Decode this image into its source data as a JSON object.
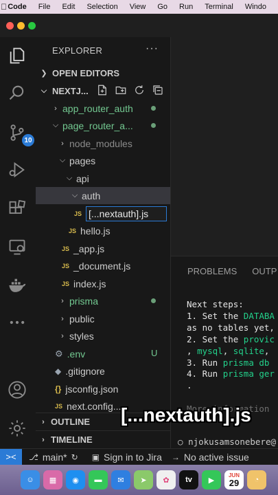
{
  "menubar": {
    "apple": "",
    "items": [
      "Code",
      "File",
      "Edit",
      "Selection",
      "View",
      "Go",
      "Run",
      "Terminal",
      "Windo"
    ]
  },
  "activity": {
    "source_control_badge": "10"
  },
  "explorer": {
    "title": "EXPLORER",
    "more": "···",
    "open_editors": "OPEN EDITORS",
    "project": "NEXTJ...",
    "tree": [
      {
        "label": "app_router_auth",
        "kind": "folder-closed"
      },
      {
        "label": "page_router_a...",
        "kind": "folder-open"
      },
      {
        "label": "node_modules",
        "kind": "folder-closed"
      },
      {
        "label": "pages",
        "kind": "folder-open"
      },
      {
        "label": "api",
        "kind": "folder-open"
      },
      {
        "label": "auth",
        "kind": "folder-open"
      },
      {
        "label": "[...nextauth].js",
        "kind": "file-editing",
        "icon": "JS"
      },
      {
        "label": "hello.js",
        "kind": "file",
        "icon": "JS"
      },
      {
        "label": "_app.js",
        "kind": "file",
        "icon": "JS"
      },
      {
        "label": "_document.js",
        "kind": "file",
        "icon": "JS"
      },
      {
        "label": "index.js",
        "kind": "file",
        "icon": "JS"
      },
      {
        "label": "prisma",
        "kind": "folder-closed"
      },
      {
        "label": "public",
        "kind": "folder-closed"
      },
      {
        "label": "styles",
        "kind": "folder-closed"
      },
      {
        "label": ".env",
        "kind": "file",
        "icon": "gear-icon",
        "status": "U"
      },
      {
        "label": ".gitignore",
        "kind": "file",
        "icon": "git-icon"
      },
      {
        "label": "jsconfig.json",
        "kind": "file",
        "icon": "{}"
      },
      {
        "label": "next.config...",
        "kind": "file",
        "icon": "JS"
      }
    ],
    "outline": "OUTLINE",
    "timeline": "TIMELINE"
  },
  "panel": {
    "tabs": [
      "PROBLEMS",
      "OUTP"
    ],
    "terminal": {
      "line1": "Next steps:",
      "line2_pre": "1. Set the ",
      "line2_hl": "DATABA",
      "line3": "as no tables yet,",
      "line4_pre": "2. Set the ",
      "line4_hl": "provic",
      "line5_pre": ", ",
      "line5_hl1": "mysql",
      "line5_mid": ", ",
      "line5_hl2": "sqlite",
      "line5_post": ",",
      "line6_pre": "3. Run ",
      "line6_hl": "prisma db",
      "line7_pre": "4. Run ",
      "line7_hl": "prisma ger",
      "line8": ".",
      "line9": "More information",
      "footer": "njokusamsonebere@"
    }
  },
  "caption": "[...nextauth].js",
  "statusbar": {
    "remote": "><",
    "branch": "main*",
    "sign_in": "Sign in to Jira",
    "no_issue": "No active issue"
  },
  "dock": {
    "calendar_month": "JUN",
    "calendar_day": "29",
    "tv": "tv"
  }
}
